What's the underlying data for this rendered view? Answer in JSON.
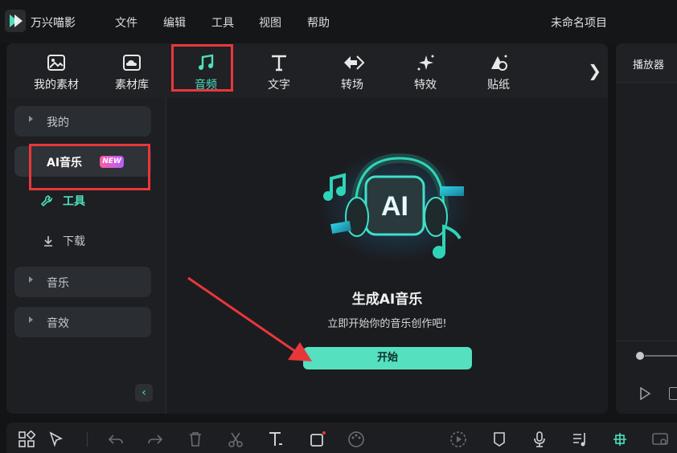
{
  "app": {
    "name": "万兴喵影",
    "project_title": "未命名项目"
  },
  "menu": [
    "文件",
    "编辑",
    "工具",
    "视图",
    "帮助"
  ],
  "tabs": [
    {
      "label": "我的素材",
      "icon": "image-icon"
    },
    {
      "label": "素材库",
      "icon": "cloud-image-icon"
    },
    {
      "label": "音频",
      "icon": "music-note-icon",
      "active": true
    },
    {
      "label": "文字",
      "icon": "text-icon"
    },
    {
      "label": "转场",
      "icon": "transition-icon"
    },
    {
      "label": "特效",
      "icon": "sparkle-effect-icon"
    },
    {
      "label": "贴纸",
      "icon": "sticker-icon"
    }
  ],
  "sidebar": {
    "mine": "我的",
    "ai_music": "AI音乐",
    "new_badge": "NEW",
    "tools": "工具",
    "download": "下载",
    "music": "音乐",
    "sound_effects": "音效"
  },
  "main": {
    "title": "生成AI音乐",
    "subtitle": "立即开始你的音乐创作吧!",
    "start_button": "开始",
    "illustration_text": "AI"
  },
  "player": {
    "title": "播放器"
  },
  "colors": {
    "accent": "#4ee0c0",
    "highlight": "#e8373b",
    "badge_start": "#ff5aa0",
    "badge_end": "#b85cff"
  }
}
